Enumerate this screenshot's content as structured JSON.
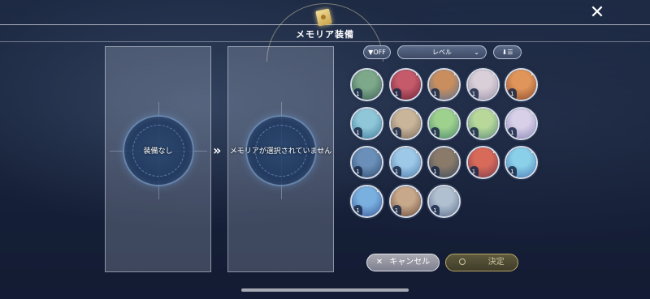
{
  "header": {
    "title": "メモリア装備",
    "close_label": "✕"
  },
  "equip": {
    "current_label": "装備なし",
    "arrow_label": "»",
    "selected_label": "メモリアが選択されていません"
  },
  "filters": {
    "off_label": "▼OFF",
    "sort_field": "レベル",
    "sort_field_chevron": "⌄",
    "order_label": "⬇☰"
  },
  "memoria_list": [
    {
      "level": "1",
      "colors": [
        "#7da88a",
        "#3b5f55"
      ]
    },
    {
      "level": "1",
      "colors": [
        "#c45a6a",
        "#6b2235"
      ]
    },
    {
      "level": "1",
      "colors": [
        "#c98e5e",
        "#5a6f8f"
      ]
    },
    {
      "level": "1",
      "colors": [
        "#d9cfd8",
        "#9a8fa8"
      ]
    },
    {
      "level": "1",
      "colors": [
        "#e0955a",
        "#8a4a2a"
      ]
    },
    {
      "level": "1",
      "colors": [
        "#8fc7d8",
        "#3d7a9a"
      ]
    },
    {
      "level": "1",
      "colors": [
        "#c9b59a",
        "#7a6a5a"
      ]
    },
    {
      "level": "1",
      "colors": [
        "#9ed08e",
        "#4a8a6a"
      ]
    },
    {
      "level": "1",
      "colors": [
        "#b8d89a",
        "#5a8a7a"
      ]
    },
    {
      "level": "1",
      "colors": [
        "#d8d0e8",
        "#8a86b8"
      ]
    },
    {
      "level": "1",
      "colors": [
        "#6a8fb8",
        "#2d4a6d"
      ]
    },
    {
      "level": "1",
      "colors": [
        "#9ec8e8",
        "#4a7aa8"
      ]
    },
    {
      "level": "1",
      "colors": [
        "#8a7a6a",
        "#3a4a5a"
      ]
    },
    {
      "level": "1",
      "colors": [
        "#d86a5a",
        "#7a3a4a"
      ]
    },
    {
      "level": "1",
      "colors": [
        "#8ad0e8",
        "#4a7ab8"
      ]
    },
    {
      "level": "1",
      "colors": [
        "#7ab0e0",
        "#3a5a9a"
      ]
    },
    {
      "level": "1",
      "colors": [
        "#c8a88a",
        "#6a4a3a"
      ]
    },
    {
      "level": "1",
      "colors": [
        "#b0c0d0",
        "#5a6a8a"
      ]
    }
  ],
  "actions": {
    "cancel_label": "キャンセル",
    "cancel_icon": "✕",
    "confirm_label": "決定"
  }
}
